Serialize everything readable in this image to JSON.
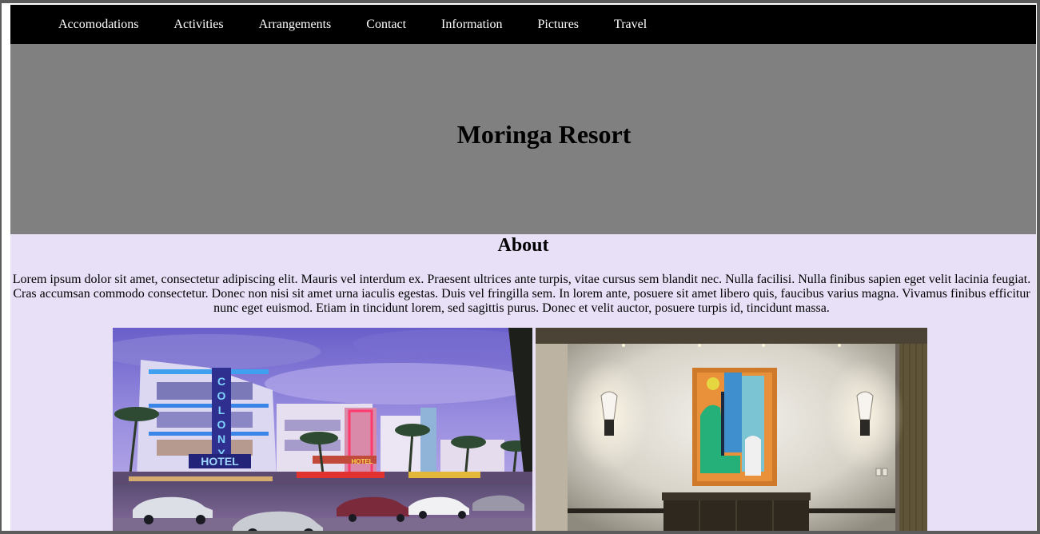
{
  "nav": {
    "items": [
      "Accomodations",
      "Activities",
      "Arrangements",
      "Contact",
      "Information",
      "Pictures",
      "Travel"
    ]
  },
  "hero": {
    "title": "Moringa Resort",
    "background_color": "#808080"
  },
  "about": {
    "heading": "About",
    "text": "Lorem ipsum dolor sit amet, consectetur adipiscing elit. Mauris vel interdum ex. Praesent ultrices ante turpis, vitae cursus sem blandit nec. Nulla facilisi. Nulla finibus sapien eget velit lacinia feugiat. Cras accumsan commodo consectetur. Donec non nisi sit amet urna iaculis egestas. Duis vel fringilla sem. In lorem ante, posuere sit amet libero quis, faucibus varius magna. Vivamus finibus efficitur nunc eget euismod. Etiam in tincidunt lorem, sed sagittis purus. Donec et velit auctor, posuere turpis id, tincidunt massa."
  },
  "photos": {
    "hotel_sign_vertical": "COLONY",
    "hotel_sign_horizontal": "HOTEL",
    "second_sign": "HOTEL"
  },
  "colors": {
    "navbar": "#000000",
    "page_background": "#e8e0f7",
    "hero": "#808080"
  }
}
